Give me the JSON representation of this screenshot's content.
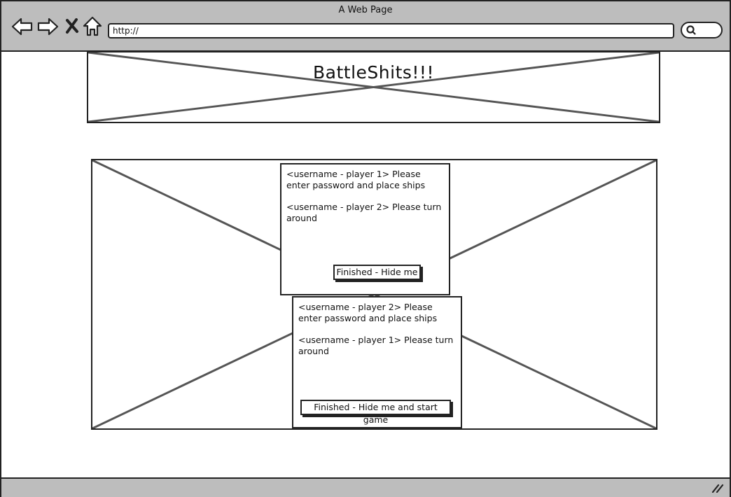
{
  "window": {
    "title": "A Web Page"
  },
  "browser": {
    "url": "http://",
    "icons": [
      "back-arrow-icon",
      "forward-arrow-icon",
      "stop-icon",
      "home-icon",
      "search-icon"
    ]
  },
  "banner": {
    "title": "BattleShits!!!"
  },
  "dialogs": [
    {
      "message_1": "<username - player 1> Please enter password and place ships",
      "message_2": "<username - player 2> Please turn around",
      "button_label": "Finished - Hide me"
    },
    {
      "message_1": "<username - player 2>  Please enter password and place ships",
      "message_2": "<username - player 1> Please turn around",
      "button_label": "Finished - Hide me and start game"
    }
  ]
}
